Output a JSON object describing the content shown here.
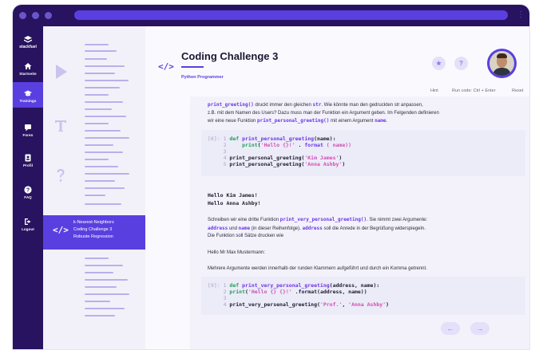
{
  "sidebar": {
    "brand": "stackfuel",
    "items": [
      {
        "label": "Startseite",
        "icon": "home-icon"
      },
      {
        "label": "Trainings",
        "icon": "graduation-cap-icon"
      },
      {
        "label": "Foren",
        "icon": "forum-icon"
      },
      {
        "label": "Profil",
        "icon": "profile-icon"
      },
      {
        "label": "FAQ",
        "icon": "help-icon"
      },
      {
        "label": "Logout",
        "icon": "logout-icon"
      }
    ]
  },
  "outline": {
    "active_lines": [
      "k-Nearest-Neighbors",
      "Coding Challenge 3",
      "Robuste Regression"
    ]
  },
  "header": {
    "code_glyph": "</>",
    "title": "Coding Challenge 3",
    "subtitle": "Python Programmer",
    "star_icon": "★",
    "question_icon": "?"
  },
  "toolbar": {
    "hint": "Hint",
    "run_code": "Run code: Ctrl + Enter",
    "reset": "Reset"
  },
  "content": {
    "p1_code1": "print_greeting()",
    "p1_a": " druckt immer den gleichen ",
    "p1_code2": "str",
    "p1_b": ". Wie könnte man den gedruckten str anpassen,",
    "p1_line2": "z.B. mit dem Namen des Users? Dazu muss man der Funktion ein Argument geben. Im Felgenden definieren",
    "p1_line3a": "wir eine neue Funktion ",
    "p1_code3": "print_personal_greeting()",
    "p1_line3b": " mit einem Argument ",
    "p1_code4": "name",
    "p1_line3c": ".",
    "cell1": {
      "prompt": "[6]:",
      "l1n": "1",
      "l1kw": "def",
      "l1fn": "print_personal_greeting",
      "l1rest": "(name):",
      "l2n": "2",
      "l2fn": "print",
      "l2a": "(",
      "l2str": "'Hello {}!'",
      "l2b": " . ",
      "l2fn2": "format",
      "l2c": " ( name))",
      "l3n": "3",
      "l4n": "4",
      "l4a": "print_personal_greeting(",
      "l4str": "'Kim James'",
      "l4b": ")",
      "l5n": "5",
      "l5a": "print_personal_greeting(",
      "l5str": "'Anna Ashby'",
      "l5b": ")"
    },
    "out1": [
      "Hello Kim James!",
      "Hello Anna Ashby!"
    ],
    "p2_a": "Schreiben wir eine dritte Funktion ",
    "p2_code1": "print_very_personal_greeting()",
    "p2_b": ". Sie nimmt zwei Argumente:",
    "p2_code2": "address",
    "p2_c": " und ",
    "p2_code3": "name",
    "p2_d": " (in dieser Reihenfolge). ",
    "p2_code4": "address",
    "p2_e": " soll die Anrede in der Begrüßung widerspiegeln.",
    "p2_line3": "Die Funktion soll Sätze drucken wie",
    "p3": "Hello Mr Max Mustermann:",
    "p4": "Mehrere Argumente werden innerhalb der runden Klammern aufgeführt und durch ein Komma getrennt.",
    "cell2": {
      "prompt": "[9]:",
      "l1n": "1",
      "l1kw": "def",
      "l1fn": "print_very_personal_greeting",
      "l1rest": "(address, name):",
      "l2n": "2",
      "l2fn": "print",
      "l2a": "(",
      "l2str": "'Hello {} {}!'",
      "l2b": " .format(address, name))",
      "l3n": "3",
      "l4n": "4",
      "l4a": "print_very_persenal_greeting(",
      "l4str": "'Prof.'",
      "l4b": ", ",
      "l4str2": "'Anna Ashby'",
      "l4c": ")"
    },
    "prev_arrow": "←",
    "next_arrow": "→"
  },
  "colors": {
    "primary": "#5a3fe0",
    "nav": "#27135f",
    "keyword": "#1f9e58",
    "string": "#d14fb0"
  }
}
